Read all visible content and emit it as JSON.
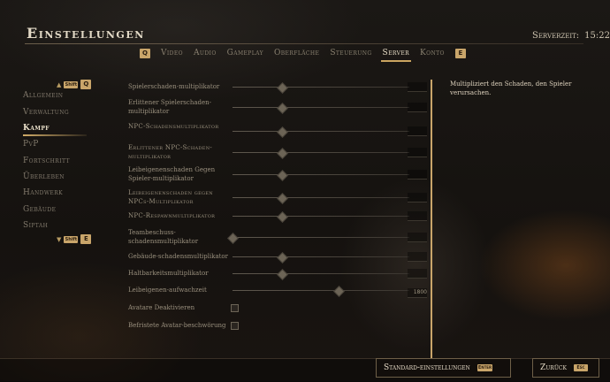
{
  "header": {
    "title": "Einstellungen",
    "server_time_label": "Serverzeit:",
    "server_time_value": "15:22"
  },
  "tabs": {
    "prev_key": "Q",
    "next_key": "E",
    "items": [
      {
        "label": "Video",
        "active": false
      },
      {
        "label": "Audio",
        "active": false
      },
      {
        "label": "Gameplay",
        "active": false
      },
      {
        "label": "Oberfläche",
        "active": false
      },
      {
        "label": "Steuerung",
        "active": false
      },
      {
        "label": "Server",
        "active": true
      },
      {
        "label": "Konto",
        "active": false
      }
    ]
  },
  "sidebar": {
    "up_hint": {
      "shift_key": "Shift",
      "key": "Q"
    },
    "down_hint": {
      "shift_key": "Shift",
      "key": "E"
    },
    "items": [
      {
        "label": "Allgemein"
      },
      {
        "label": "Verwaltung"
      },
      {
        "label": "Kampf",
        "active": true
      },
      {
        "label": "PvP"
      },
      {
        "label": "Fortschritt"
      },
      {
        "label": "Überleben"
      },
      {
        "label": "Handwerk"
      },
      {
        "label": "Gebäude"
      },
      {
        "label": "Siptah"
      }
    ]
  },
  "settings": [
    {
      "label": "Spielerschaden-multiplikator",
      "type": "slider",
      "level": 0.28,
      "value": ""
    },
    {
      "label": "Erlittener Spielerschaden-multiplikator",
      "type": "slider",
      "level": 0.28,
      "value": ""
    },
    {
      "label": "NPC-Schadensmultiplikator",
      "type": "slider",
      "level": 0.28,
      "value": ""
    },
    {
      "label": "Erlittener NPC-Schaden-multiplikator",
      "type": "slider",
      "level": 0.28,
      "value": ""
    },
    {
      "label": "Leibeigenenschaden Gegen Spieler-multiplikator",
      "type": "slider",
      "level": 0.28,
      "value": ""
    },
    {
      "label": "Leibeigenenschaden gegen NPCs-Multiplikator",
      "type": "slider",
      "level": 0.28,
      "value": ""
    },
    {
      "label": "NPC-Respawnmultiplikator",
      "type": "slider",
      "level": 0.28,
      "value": ""
    },
    {
      "label": "Teambeschuss-schadensmultiplikator",
      "type": "slider",
      "level": 0.0,
      "value": ""
    },
    {
      "label": "Gebäude-schadensmultiplikator",
      "type": "slider",
      "level": 0.28,
      "value": ""
    },
    {
      "label": "Haltbarkeitsmultiplikator",
      "type": "slider",
      "level": 0.28,
      "value": ""
    },
    {
      "label": "Leibeigenen-aufwachzeit",
      "type": "slider",
      "level": 0.6,
      "value": "1800"
    },
    {
      "label": "Avatare Deaktivieren",
      "type": "checkbox",
      "checked": false
    },
    {
      "label": "Befristete Avatar-beschwörung",
      "type": "checkbox",
      "checked": false
    }
  ],
  "description": "Multipliziert den Schaden, den Spieler verursachen.",
  "footer": {
    "defaults_label": "Standard-einstellungen",
    "defaults_key": "Enter",
    "back_label": "Zurück",
    "back_key": "Esc"
  },
  "colors": {
    "accent": "#c9a56a",
    "active_text": "#ece2cc",
    "inactive_text": "#827a6c"
  }
}
